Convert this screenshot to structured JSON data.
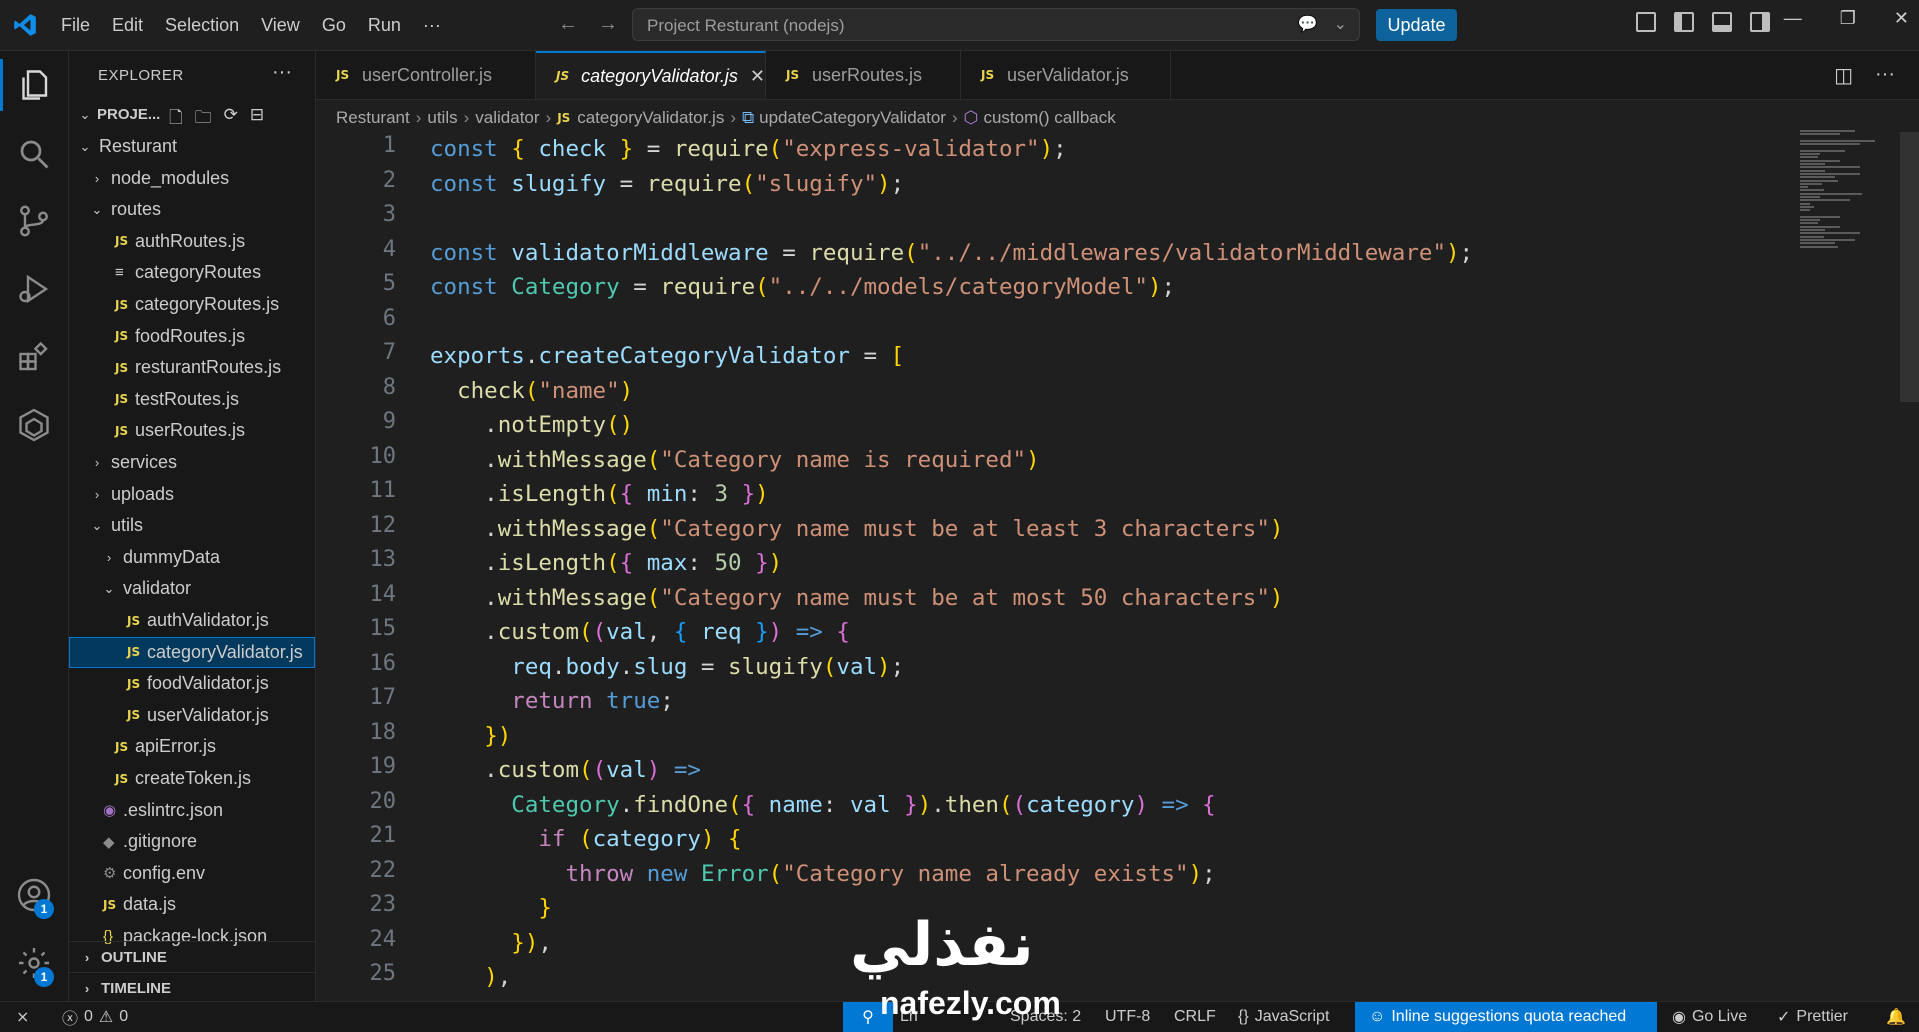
{
  "titlebar": {
    "menu": [
      "File",
      "Edit",
      "Selection",
      "View",
      "Go",
      "Run",
      "···"
    ],
    "search": "Project Resturant (nodejs)",
    "update": "Update"
  },
  "sidebar": {
    "title": "EXPLORER",
    "project": "PROJE...",
    "items": [
      {
        "label": "Resturant",
        "depth": 0,
        "kind": "folder-open"
      },
      {
        "label": "node_modules",
        "depth": 1,
        "kind": "folder"
      },
      {
        "label": "routes",
        "depth": 1,
        "kind": "folder-open"
      },
      {
        "label": "authRoutes.js",
        "depth": 2,
        "kind": "js"
      },
      {
        "label": "categoryRoutes",
        "depth": 2,
        "kind": "text"
      },
      {
        "label": "categoryRoutes.js",
        "depth": 2,
        "kind": "js"
      },
      {
        "label": "foodRoutes.js",
        "depth": 2,
        "kind": "js"
      },
      {
        "label": "resturantRoutes.js",
        "depth": 2,
        "kind": "js"
      },
      {
        "label": "testRoutes.js",
        "depth": 2,
        "kind": "js"
      },
      {
        "label": "userRoutes.js",
        "depth": 2,
        "kind": "js"
      },
      {
        "label": "services",
        "depth": 1,
        "kind": "folder"
      },
      {
        "label": "uploads",
        "depth": 1,
        "kind": "folder"
      },
      {
        "label": "utils",
        "depth": 1,
        "kind": "folder-open"
      },
      {
        "label": "dummyData",
        "depth": 2,
        "kind": "folder"
      },
      {
        "label": "validator",
        "depth": 2,
        "kind": "folder-open"
      },
      {
        "label": "authValidator.js",
        "depth": 3,
        "kind": "js"
      },
      {
        "label": "categoryValidator.js",
        "depth": 3,
        "kind": "js",
        "selected": true
      },
      {
        "label": "foodValidator.js",
        "depth": 3,
        "kind": "js"
      },
      {
        "label": "userValidator.js",
        "depth": 3,
        "kind": "js"
      },
      {
        "label": "apiError.js",
        "depth": 2,
        "kind": "js"
      },
      {
        "label": "createToken.js",
        "depth": 2,
        "kind": "js"
      },
      {
        "label": ".eslintrc.json",
        "depth": 1,
        "kind": "eslint"
      },
      {
        "label": ".gitignore",
        "depth": 1,
        "kind": "git"
      },
      {
        "label": "config.env",
        "depth": 1,
        "kind": "gear"
      },
      {
        "label": "data.js",
        "depth": 1,
        "kind": "js"
      },
      {
        "label": "package-lock.json",
        "depth": 1,
        "kind": "json"
      }
    ],
    "outline": "OUTLINE",
    "timeline": "TIMELINE"
  },
  "tabs": [
    {
      "label": "userController.js",
      "active": false
    },
    {
      "label": "categoryValidator.js",
      "active": true
    },
    {
      "label": "userRoutes.js",
      "active": false
    },
    {
      "label": "userValidator.js",
      "active": false
    }
  ],
  "breadcrumb": [
    "Resturant",
    "utils",
    "validator",
    "categoryValidator.js",
    "updateCategoryValidator",
    "custom() callback"
  ],
  "line_numbers": [
    "1",
    "2",
    "3",
    "4",
    "5",
    "6",
    "7",
    "8",
    "9",
    "10",
    "11",
    "12",
    "13",
    "14",
    "15",
    "16",
    "17",
    "18",
    "19",
    "20",
    "21",
    "22",
    "23",
    "24",
    "25"
  ],
  "code_lines": [
    "const { check } = require(\"express-validator\");",
    "const slugify = require(\"slugify\");",
    "",
    "const validatorMiddleware = require(\"../../middlewares/validatorMiddleware\");",
    "const Category = require(\"../../models/categoryModel\");",
    "",
    "exports.createCategoryValidator = [",
    "  check(\"name\")",
    "    .notEmpty()",
    "    .withMessage(\"Category name is required\")",
    "    .isLength({ min: 3 })",
    "    .withMessage(\"Category name must be at least 3 characters\")",
    "    .isLength({ max: 50 })",
    "    .withMessage(\"Category name must be at most 50 characters\")",
    "    .custom((val, { req }) => {",
    "      req.body.slug = slugify(val);",
    "      return true;",
    "    })",
    "    .custom((val) =>",
    "      Category.findOne({ name: val }).then((category) => {",
    "        if (category) {",
    "          throw new Error(\"Category name already exists\");",
    "        }",
    "      }),",
    "    ),"
  ],
  "statusbar": {
    "errors": "0",
    "warnings": "0",
    "spaces": "Spaces: 2",
    "encoding": "UTF-8",
    "eol": "CRLF",
    "language": "JavaScript",
    "inline": "Inline suggestions quota reached",
    "golive": "Go Live",
    "prettier": "Prettier",
    "partial": "Ln"
  },
  "watermark": {
    "text": "نفذلي",
    "sub": "nafezly.com"
  },
  "colors": {
    "accent": "#0078d4",
    "update": "#0e639c",
    "js": "#e8d44d"
  }
}
